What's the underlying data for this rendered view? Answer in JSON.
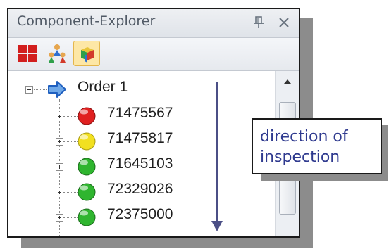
{
  "panel": {
    "title": "Component-Explorer",
    "pin_icon": "pin-icon",
    "close_icon": "close-icon"
  },
  "toolbar": {
    "buttons": [
      {
        "icon": "grid-layout-icon",
        "active": false
      },
      {
        "icon": "people-hierarchy-icon",
        "active": false
      },
      {
        "icon": "components-cubes-icon",
        "active": true
      }
    ]
  },
  "tree": {
    "root": {
      "label": "Order 1",
      "icon": "blue-arrow-icon",
      "expanded": true
    },
    "items": [
      {
        "label": "71475567",
        "status_color": "#e02020"
      },
      {
        "label": "71475817",
        "status_color": "#f2e020"
      },
      {
        "label": "71645103",
        "status_color": "#2fb52f"
      },
      {
        "label": "72329026",
        "status_color": "#2fb52f"
      },
      {
        "label": "72375000",
        "status_color": "#2fb52f"
      }
    ]
  },
  "annotation": {
    "text": "direction of inspection",
    "color": "#2f3a8f"
  }
}
